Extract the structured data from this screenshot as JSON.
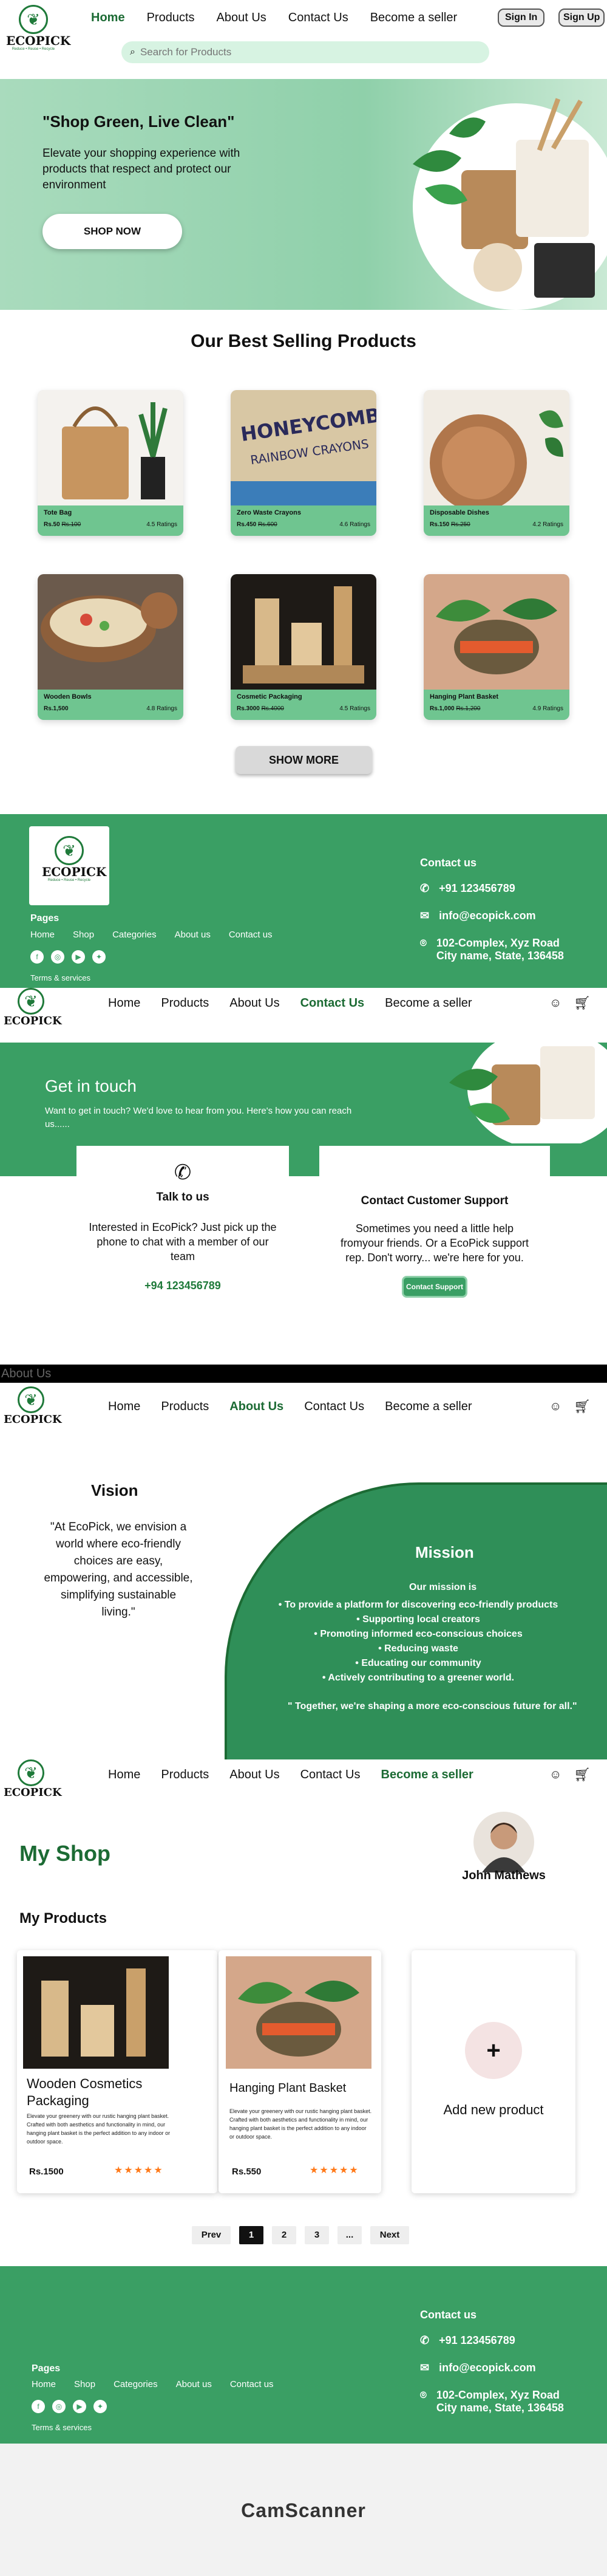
{
  "brand": {
    "name": "ECOPICK",
    "tagline": "Reduce • Reuse • Recycle"
  },
  "header1": {
    "nav": [
      "Home",
      "Products",
      "About Us",
      "Contact Us",
      "Become a seller"
    ],
    "signin": "Sign In",
    "signup": "Sign Up",
    "search_placeholder": "Search for Products"
  },
  "hero": {
    "title": "\"Shop Green,  Live Clean\"",
    "text": "Elevate your shopping experience with products that respect and protect our environment",
    "cta": "SHOP NOW"
  },
  "bestsellers": {
    "title": "Our Best Selling Products",
    "show_more": "SHOW MORE",
    "items": [
      {
        "name": "Tote Bag",
        "price": "Rs.50",
        "old": "Rs.100",
        "rating": "4.5 Ratings"
      },
      {
        "name": "Zero Waste Crayons",
        "price": "Rs.450",
        "old": "Rs.600",
        "rating": "4.6 Ratings"
      },
      {
        "name": "Disposable Dishes",
        "price": "Rs.150",
        "old": "Rs.250",
        "rating": "4.2 Ratings"
      },
      {
        "name": "Wooden Bowls",
        "price": "Rs.1,500",
        "old": "",
        "rating": "4.8 Ratings"
      },
      {
        "name": "Cosmetic Packaging",
        "price": "Rs.3000",
        "old": "Rs.4000",
        "rating": "4.5 Ratings"
      },
      {
        "name": "Hanging Plant Basket",
        "price": "Rs.1,000",
        "old": "Rs.1,200",
        "rating": "4.9 Ratings"
      }
    ]
  },
  "footer": {
    "contact_title": "Contact us",
    "phone": "+91 123456789",
    "email": "info@ecopick.com",
    "address_line1": "102-Complex, Xyz Road",
    "address_line2": "City name, State, 136458",
    "pages_title": "Pages",
    "links": [
      "Home",
      "Shop",
      "Categories",
      "About us",
      "Contact us"
    ],
    "terms": "Terms & services"
  },
  "header2": {
    "nav": [
      "Home",
      "Products",
      "About Us",
      "Contact Us",
      "Become a seller"
    ]
  },
  "contact": {
    "title": "Get in touch",
    "text": "Want to get in touch? We'd love to hear from you. Here's how you can reach us......",
    "talk_title": "Talk to us",
    "talk_text": "Interested in EcoPick? Just pick up the phone to chat with a member of our team",
    "talk_phone": "+94  123456789",
    "support_title": "Contact Customer Support",
    "support_text": "Sometimes you need a little help fromyour friends. Or a EcoPick support rep. Don't worry... we're here for you.",
    "support_btn": "Contact Support"
  },
  "about": {
    "label": "About Us",
    "vision_title": "Vision",
    "vision_text": "\"At EcoPick, we envision a world where eco-friendly choices are easy, empowering, and accessible, simplifying sustainable living.\"",
    "mission_title": "Mission",
    "mission_intro": "Our mission is",
    "mission_points": [
      "• To provide a platform for discovering eco-friendly products",
      "• Supporting local creators",
      "• Promoting informed eco-conscious choices",
      "• Reducing waste",
      "• Educating our community",
      "• Actively contributing to a greener world."
    ],
    "mission_close": "\" Together, we're shaping a more eco-conscious future for all.\""
  },
  "shop": {
    "title": "My Shop",
    "owner": "John Mathews",
    "products_title": "My Products",
    "items": [
      {
        "name": "Wooden Cosmetics Packaging",
        "desc": "Elevate your greenery with our rustic hanging plant basket. Crafted with both aesthetics and functionality in mind, our hanging plant basket is the perfect addition to any indoor or outdoor space.",
        "price": "Rs.1500",
        "stars": "★★★★★"
      },
      {
        "name": "Hanging Plant Basket",
        "desc": "Elevate your greenery with our rustic hanging plant basket. Crafted with both aesthetics and functionality in mind, our hanging plant basket is the perfect addition to any indoor or outdoor space.",
        "price": "Rs.550",
        "stars": "★★★★★"
      }
    ],
    "add_label": "Add new product",
    "add_symbol": "+",
    "pagination": [
      "Prev",
      "1",
      "2",
      "3",
      "...",
      "Next"
    ]
  },
  "scanner": "CamScanner",
  "colors": {
    "primary": "#3a9f64",
    "dark": "#1c6b34",
    "light": "#a9dbbd"
  }
}
